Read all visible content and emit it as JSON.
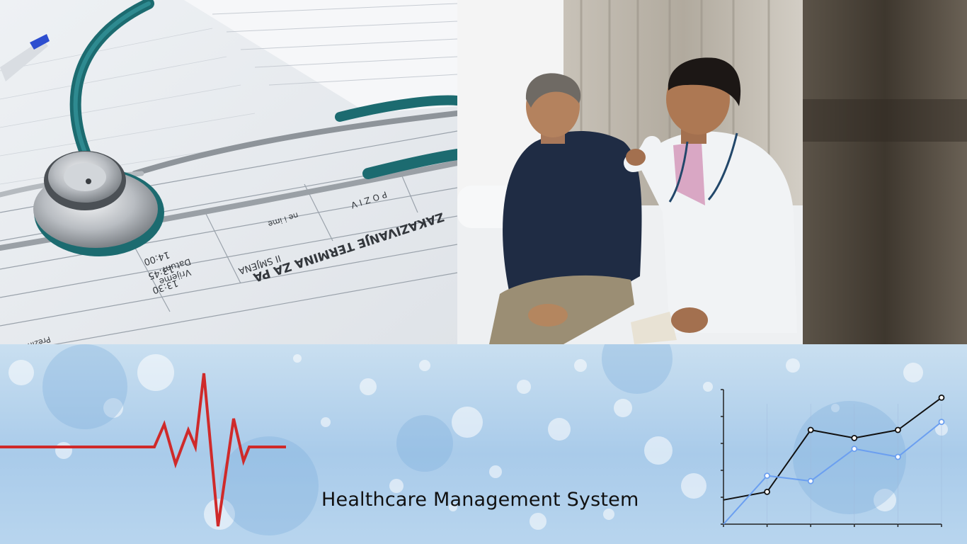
{
  "banner": {
    "title": "Healthcare Management System",
    "accent_colors": {
      "heartbeat": "#cf2a2a",
      "series_dark": "#111111",
      "series_light": "#6b9ff0"
    }
  },
  "photos": [
    {
      "id": "stethoscope-form",
      "description_hint": "stethoscope on appointment form"
    },
    {
      "id": "doctor-patient",
      "description_hint": "doctor consulting patient"
    }
  ],
  "form_text": {
    "heading": "ZAKAZIVANJE TERMINA ZA PA",
    "shift": "II SMJENA",
    "row1": "POZIV",
    "row2": "ne i ime",
    "col1": "Datum",
    "col2": "Vrijeme",
    "col3": "Prezime i ime",
    "times": [
      "13:30",
      "13:45",
      "14:00"
    ]
  },
  "chart_data": {
    "type": "line",
    "x": [
      0,
      1,
      2,
      3,
      4,
      5
    ],
    "series": [
      {
        "values": [
          0.9,
          1.2,
          3.5,
          3.2,
          3.5,
          4.7
        ],
        "color": "#111111"
      },
      {
        "values": [
          0.0,
          1.8,
          1.6,
          2.8,
          2.5,
          3.8
        ],
        "color": "#6b9ff0"
      }
    ],
    "ylim": [
      0,
      5
    ],
    "grid": false
  }
}
